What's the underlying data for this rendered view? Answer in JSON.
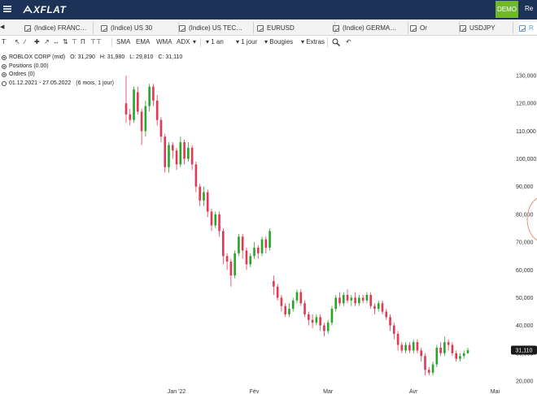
{
  "app": {
    "logo_text": "XFLAT",
    "mode_badge": "DEMO",
    "top_right_text": "Re"
  },
  "tabs": [
    {
      "label": "(Indice) FRANC…",
      "active": false
    },
    {
      "label": "(Indice) US 30",
      "active": false
    },
    {
      "label": "(Indice) US TEC…",
      "active": false
    },
    {
      "label": "EURUSD",
      "active": false
    },
    {
      "label": "(Indice) GERMA…",
      "active": false
    },
    {
      "label": "Or",
      "active": false
    },
    {
      "label": "USDJPY",
      "active": false
    },
    {
      "label": "R",
      "active": true
    }
  ],
  "toolbar": {
    "indicators": [
      "SMA",
      "EMA",
      "WMA",
      "ADX"
    ],
    "period": "1 an",
    "interval": "1 jour",
    "chart_type": "Bougies",
    "extras": "Extras"
  },
  "info": {
    "instrument": "ROBLOX CORP (mid)",
    "open": "O: 31,290",
    "high": "H: 31,980",
    "low": "L: 29,810",
    "close": "C: 31,110",
    "positions": "Positions (0.00)",
    "orders": "Ordres (0)",
    "date_range": "01.12.2021 - 27.05.2022",
    "range_detail": "(6 mois, 1 jour)"
  },
  "colors": {
    "up": "#2aa52a",
    "down": "#e03a56",
    "topbar": "#1c3257",
    "badge": "#6fb82e",
    "accent": "#5aa0d8"
  },
  "chart_data": {
    "type": "candlestick",
    "title": "ROBLOX CORP (mid)",
    "ylim": [
      20000,
      130000
    ],
    "y_ticks": [
      20000,
      30000,
      40000,
      50000,
      60000,
      70000,
      80000,
      90000,
      100000,
      110000,
      120000,
      130000
    ],
    "y_tick_labels": [
      "20,000",
      "30,000",
      "40,000",
      "50,000",
      "60,000",
      "70,000",
      "80,000",
      "90,000",
      "100,000",
      "110,000",
      "120,000",
      "130,000"
    ],
    "x_tick_labels": [
      "Jan '22",
      "Fév",
      "Mar",
      "Avr",
      "Mai"
    ],
    "x_tick_index": [
      13,
      33,
      52,
      74,
      95
    ],
    "last_price": 31110,
    "last_price_label": "31,110",
    "grid": false,
    "candles": [
      [
        120000,
        116000,
        130000,
        113000
      ],
      [
        116000,
        114000,
        118000,
        112000
      ],
      [
        114000,
        125000,
        126000,
        113000
      ],
      [
        124000,
        117000,
        126000,
        116000
      ],
      [
        117000,
        110000,
        118000,
        105000
      ],
      [
        110000,
        119000,
        121000,
        108000
      ],
      [
        119000,
        126000,
        127000,
        117000
      ],
      [
        126000,
        121000,
        127000,
        119000
      ],
      [
        121000,
        114000,
        123000,
        112000
      ],
      [
        114000,
        108000,
        115000,
        106000
      ],
      [
        108000,
        97000,
        109000,
        95000
      ],
      [
        97000,
        105000,
        106000,
        95000
      ],
      [
        105000,
        103000,
        106000,
        100000
      ],
      [
        103000,
        98000,
        104000,
        96000
      ],
      [
        98000,
        106000,
        108000,
        97000
      ],
      [
        106000,
        100000,
        107000,
        98000
      ],
      [
        100000,
        104000,
        106000,
        99000
      ],
      [
        104000,
        98000,
        105000,
        96000
      ],
      [
        98000,
        90000,
        99000,
        88000
      ],
      [
        90000,
        85000,
        91000,
        83000
      ],
      [
        85000,
        88000,
        90000,
        83000
      ],
      [
        88000,
        81000,
        89000,
        79000
      ],
      [
        81000,
        76000,
        82000,
        74000
      ],
      [
        76000,
        80000,
        81000,
        75000
      ],
      [
        80000,
        74000,
        81000,
        72000
      ],
      [
        74000,
        65000,
        75000,
        62000
      ],
      [
        65000,
        63000,
        66000,
        60000
      ],
      [
        63000,
        58000,
        64000,
        54000
      ],
      [
        58000,
        66000,
        67000,
        57000
      ],
      [
        66000,
        72000,
        73000,
        65000
      ],
      [
        72000,
        67000,
        73000,
        64000
      ],
      [
        67000,
        62000,
        68000,
        60000
      ],
      [
        62000,
        65000,
        66000,
        61000
      ],
      [
        65000,
        68000,
        70000,
        64000
      ],
      [
        68000,
        66000,
        69000,
        64000
      ],
      [
        66000,
        71000,
        72000,
        65000
      ],
      [
        71000,
        68000,
        72000,
        66000
      ],
      [
        68000,
        74000,
        75000,
        67000
      ],
      [
        56000,
        54000,
        58000,
        51000
      ],
      [
        54000,
        50000,
        55000,
        49000
      ],
      [
        50000,
        47000,
        51000,
        45000
      ],
      [
        47000,
        44000,
        48000,
        43000
      ],
      [
        44000,
        46000,
        48000,
        43000
      ],
      [
        46000,
        49000,
        50000,
        45000
      ],
      [
        49000,
        52000,
        53000,
        48000
      ],
      [
        52000,
        48000,
        53000,
        47000
      ],
      [
        48000,
        44000,
        49000,
        43000
      ],
      [
        44000,
        42000,
        45000,
        40000
      ],
      [
        42000,
        41000,
        44000,
        39000
      ],
      [
        41000,
        43000,
        44000,
        40000
      ],
      [
        43000,
        40000,
        44000,
        38000
      ],
      [
        40000,
        38000,
        41000,
        36000
      ],
      [
        38000,
        41000,
        42000,
        37000
      ],
      [
        41000,
        46000,
        47000,
        40000
      ],
      [
        46000,
        50000,
        51000,
        45000
      ],
      [
        50000,
        48000,
        52000,
        47000
      ],
      [
        48000,
        51000,
        52000,
        47000
      ],
      [
        51000,
        49000,
        53000,
        48000
      ],
      [
        49000,
        50000,
        51000,
        47000
      ],
      [
        50000,
        48000,
        52000,
        47000
      ],
      [
        48000,
        50000,
        51000,
        47000
      ],
      [
        50000,
        49000,
        51000,
        48000
      ],
      [
        49000,
        51000,
        52000,
        48000
      ],
      [
        51000,
        47000,
        52000,
        46000
      ],
      [
        47000,
        46000,
        48000,
        44000
      ],
      [
        46000,
        48000,
        49000,
        45000
      ],
      [
        48000,
        45000,
        49000,
        44000
      ],
      [
        45000,
        43000,
        46000,
        42000
      ],
      [
        43000,
        40000,
        44000,
        38000
      ],
      [
        40000,
        37000,
        41000,
        35000
      ],
      [
        37000,
        33000,
        38000,
        31000
      ],
      [
        33000,
        31000,
        34000,
        30000
      ],
      [
        31000,
        33000,
        34000,
        30000
      ],
      [
        33000,
        31000,
        34000,
        30000
      ],
      [
        31000,
        34000,
        35000,
        30000
      ],
      [
        34000,
        31000,
        35000,
        30000
      ],
      [
        31000,
        29000,
        32000,
        27000
      ],
      [
        29000,
        24000,
        30000,
        22000
      ],
      [
        24000,
        23000,
        25000,
        22000
      ],
      [
        23000,
        26000,
        27000,
        22000
      ],
      [
        26000,
        32000,
        33000,
        25000
      ],
      [
        32000,
        30000,
        34000,
        29000
      ],
      [
        30000,
        34000,
        36000,
        29000
      ],
      [
        34000,
        33000,
        35000,
        31000
      ],
      [
        33000,
        30000,
        34000,
        29000
      ],
      [
        30000,
        28000,
        31000,
        27000
      ],
      [
        28000,
        29000,
        30000,
        27000
      ],
      [
        29000,
        30000,
        31000,
        28000
      ],
      [
        30000,
        31110,
        31980,
        29810
      ]
    ]
  }
}
